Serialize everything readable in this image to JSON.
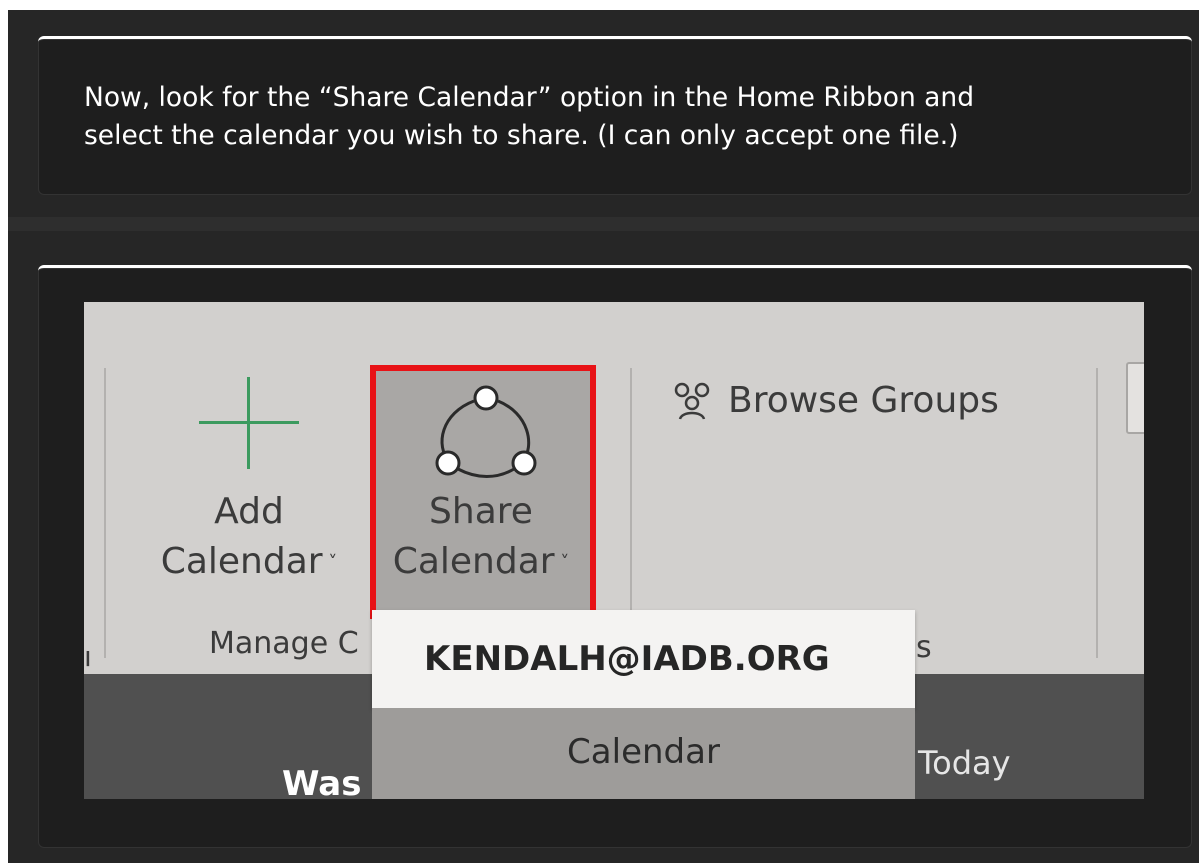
{
  "instruction": {
    "line1": "Now, look for the “Share Calendar” option in the Home Ribbon and",
    "line2": "select the calendar you wish to share. (I can only accept one file.)"
  },
  "screenshot": {
    "add_calendar": {
      "line1": "Add",
      "line2": "Calendar"
    },
    "share_calendar": {
      "line1": "Share",
      "line2": "Calendar"
    },
    "browse_groups": "Browse Groups",
    "group_label_fragment": "Manage C",
    "left_fragment": "ı",
    "right_group_fragment": "s",
    "dropdown": {
      "account": "KENDALH@IADB.ORG",
      "item": "Calendar"
    },
    "bottom_left_fragment": "Was",
    "bottom_right_fragment": "Today",
    "bottom_right_sub_fragment": "...."
  },
  "colors": {
    "highlight": "#e81216",
    "add_icon": "#3c9a5f",
    "ribbon": "#d2d0ce"
  }
}
